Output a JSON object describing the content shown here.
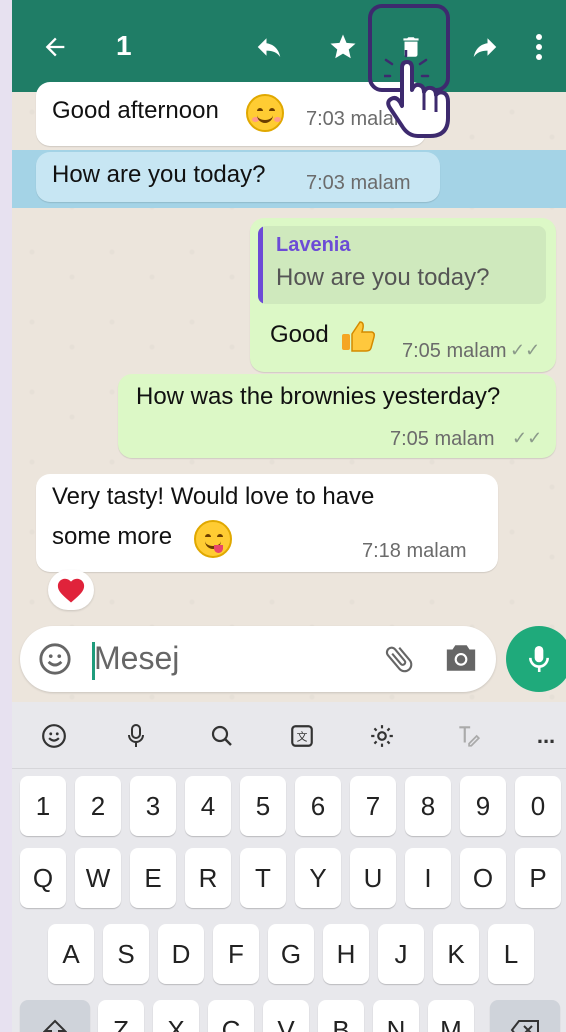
{
  "header": {
    "selected_count": "1",
    "icons": [
      "back-arrow-icon",
      "reply-icon",
      "star-icon",
      "trash-icon",
      "forward-icon",
      "more-vert-icon"
    ],
    "color": "#1f7d66"
  },
  "messages": [
    {
      "text": "Good afternoon",
      "time": "7:03 malam",
      "direction": "incoming",
      "emoji": "smile"
    },
    {
      "text": "How are you today?",
      "time": "7:03 malam",
      "direction": "incoming",
      "selected": true
    },
    {
      "quote_name": "Lavenia",
      "quote_text": "How are you today?",
      "text": "Good",
      "time": "7:05 malam",
      "direction": "outgoing",
      "emoji": "thumbs-up"
    },
    {
      "text": "How was the brownies yesterday?",
      "time": "7:05 malam",
      "direction": "outgoing"
    },
    {
      "text_line1": "Very tasty! Would love to have",
      "text_line2": "some more",
      "time": "7:18 malam",
      "direction": "incoming",
      "emoji": "yum",
      "reaction": "heart"
    }
  ],
  "composer": {
    "placeholder": "Mesej"
  },
  "keyboard": {
    "numbers": [
      "1",
      "2",
      "3",
      "4",
      "5",
      "6",
      "7",
      "8",
      "9",
      "0"
    ],
    "row1": [
      "Q",
      "W",
      "E",
      "R",
      "T",
      "Y",
      "U",
      "I",
      "O",
      "P"
    ],
    "row2": [
      "A",
      "S",
      "D",
      "F",
      "G",
      "H",
      "J",
      "K",
      "L"
    ],
    "row3": [
      "Z",
      "X",
      "C",
      "V",
      "B",
      "N",
      "M"
    ],
    "toolbar_more": "..."
  }
}
